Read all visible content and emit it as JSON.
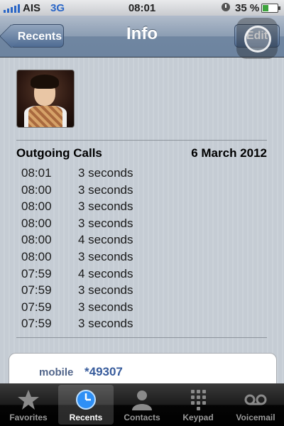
{
  "status_bar": {
    "carrier": "AIS",
    "network": "3G",
    "time": "08:01",
    "battery_percent": "35 %",
    "battery_level": 0.35,
    "accent_color": "#2a66c7"
  },
  "nav": {
    "back_label": "Recents",
    "title": "Info",
    "edit_label": "Edit"
  },
  "calls": {
    "title": "Outgoing Calls",
    "date": "6 March 2012",
    "rows": [
      {
        "time": "08:01",
        "duration": "3 seconds"
      },
      {
        "time": "08:00",
        "duration": "3 seconds"
      },
      {
        "time": "08:00",
        "duration": "3 seconds"
      },
      {
        "time": "08:00",
        "duration": "3 seconds"
      },
      {
        "time": "08:00",
        "duration": "4 seconds"
      },
      {
        "time": "08:00",
        "duration": "3 seconds"
      },
      {
        "time": "07:59",
        "duration": "4 seconds"
      },
      {
        "time": "07:59",
        "duration": "3 seconds"
      },
      {
        "time": "07:59",
        "duration": "3 seconds"
      },
      {
        "time": "07:59",
        "duration": "3 seconds"
      }
    ]
  },
  "number": {
    "type": "mobile",
    "value": "*49307"
  },
  "tabs": [
    {
      "label": "Favorites",
      "icon": "star-icon",
      "active": false
    },
    {
      "label": "Recents",
      "icon": "clock-icon",
      "active": true
    },
    {
      "label": "Contacts",
      "icon": "person-icon",
      "active": false
    },
    {
      "label": "Keypad",
      "icon": "keypad-icon",
      "active": false
    },
    {
      "label": "Voicemail",
      "icon": "voicemail-icon",
      "active": false
    }
  ]
}
